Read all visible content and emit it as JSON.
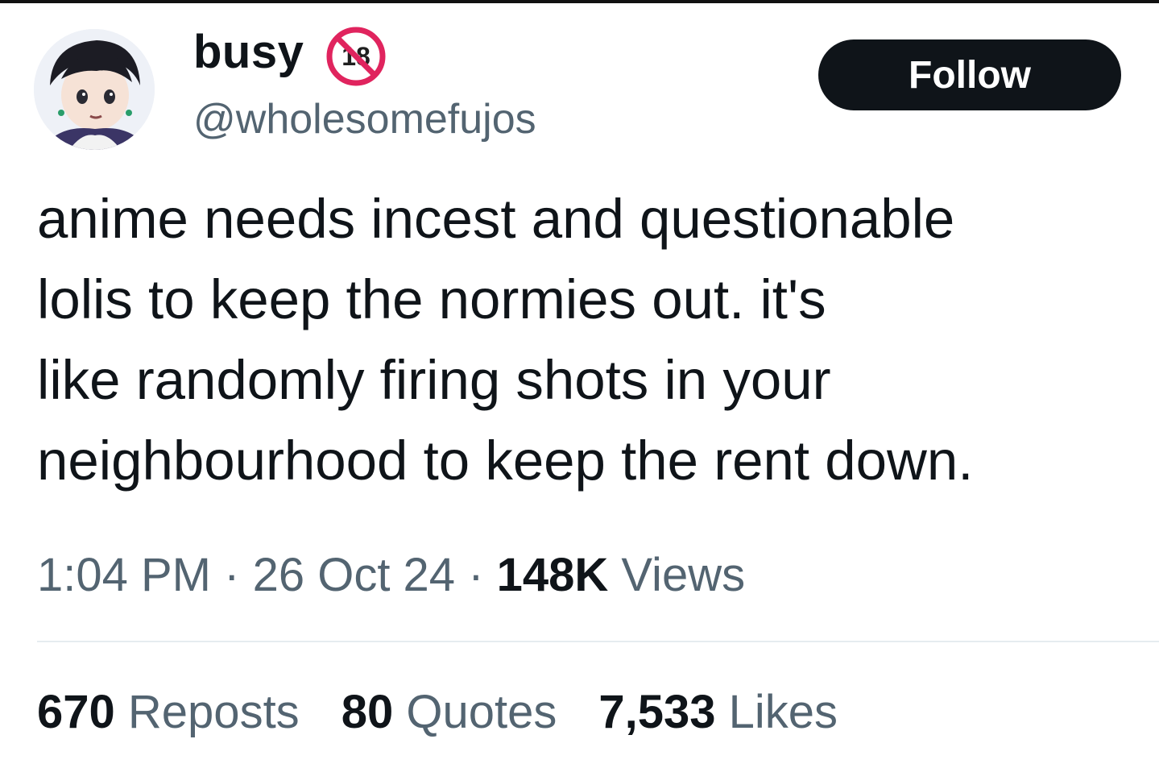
{
  "user": {
    "display_name": "busy",
    "badge_text": "18",
    "handle": "@wholesomefujos"
  },
  "follow_button": {
    "label": "Follow"
  },
  "tweet": {
    "lines": [
      "anime needs incest and questionable",
      "lolis to keep the normies out. it's",
      "like randomly firing shots in your",
      "neighbourhood to keep the rent down."
    ]
  },
  "meta": {
    "time": "1:04 PM",
    "separator": "·",
    "date": "26 Oct 24",
    "views_count": "148K",
    "views_label": "Views"
  },
  "stats": {
    "reposts_count": "670",
    "reposts_label": "Reposts",
    "quotes_count": "80",
    "quotes_label": "Quotes",
    "likes_count": "7,533",
    "likes_label": "Likes"
  },
  "colors": {
    "text_primary": "#0f1419",
    "text_secondary": "#536471",
    "follow_bg": "#0f1419",
    "badge_red": "#e0245e"
  },
  "icons": {
    "avatar": "anime-character-avatar",
    "badge": "no-under-18-icon"
  }
}
